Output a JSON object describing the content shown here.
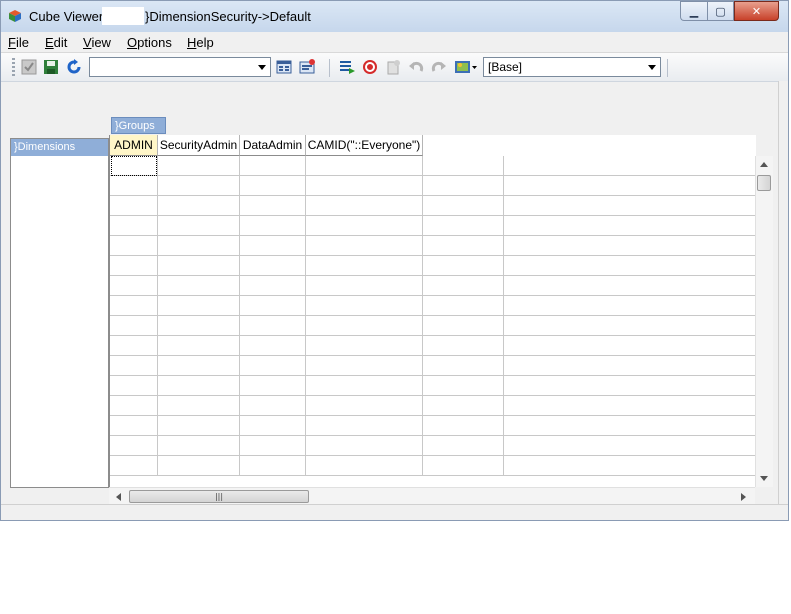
{
  "window": {
    "title_prefix": "Cube Viewer:",
    "title_suffix": "}DimensionSecurity->Default"
  },
  "menu": [
    {
      "label": "File",
      "u": "F",
      "rest": "ile"
    },
    {
      "label": "Edit",
      "u": "E",
      "rest": "dit"
    },
    {
      "label": "View",
      "u": "V",
      "rest": "iew"
    },
    {
      "label": "Options",
      "u": "O",
      "rest": "ptions"
    },
    {
      "label": "Help",
      "u": "H",
      "rest": "elp"
    }
  ],
  "toolbar": {
    "view_combo_value": "",
    "subset_combo_value": "[Base]"
  },
  "panels": {
    "groups_tab": "}Groups",
    "dimensions_tab": "}Dimensions"
  },
  "grid": {
    "columns": [
      "ADMIN",
      "SecurityAdmin",
      "DataAdmin",
      "CAMID(\"::Everyone\")"
    ],
    "active_column": 0,
    "row_count": 16
  },
  "colors": {
    "tab_blue": "#8faed8",
    "active_header": "#fff6c8"
  },
  "icons": [
    "app-cube-icon",
    "check-icon",
    "save-icon",
    "refresh-icon",
    "calculate-icon",
    "settings-icon",
    "export-icon",
    "stop-icon",
    "sandbox-icon",
    "undo-icon",
    "redo-icon",
    "picture-icon"
  ]
}
